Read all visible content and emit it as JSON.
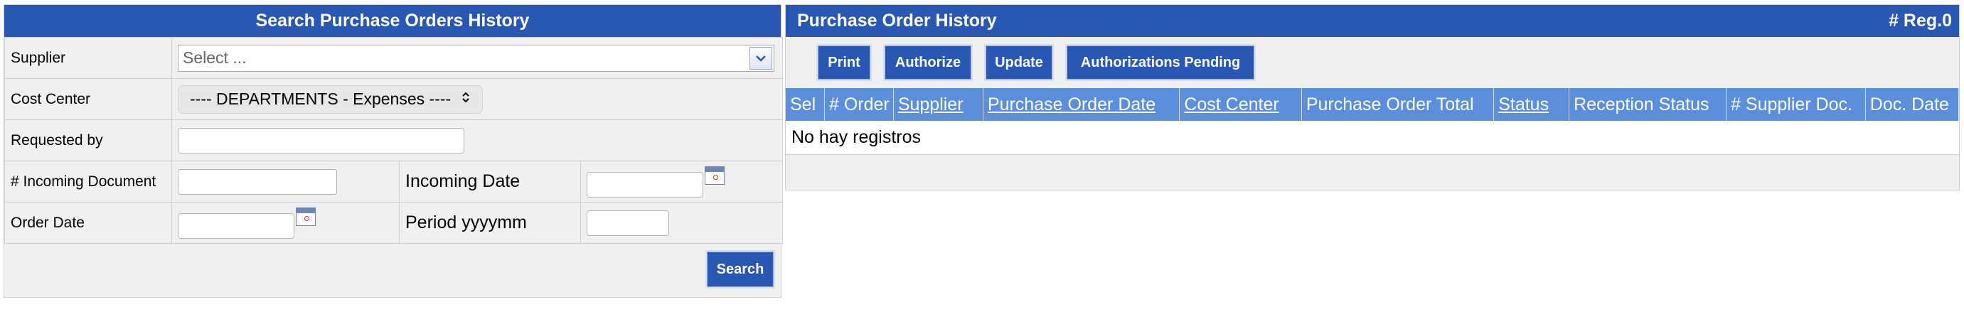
{
  "search": {
    "title": "Search Purchase Orders History",
    "supplier_label": "Supplier",
    "supplier_placeholder": "Select ...",
    "cost_center_label": "Cost Center",
    "cost_center_value": "---- DEPARTMENTS - Expenses ----",
    "requested_by_label": "Requested by",
    "incoming_doc_label": "# Incoming Document",
    "incoming_date_label": "Incoming Date",
    "order_date_label": "Order Date",
    "period_label": "Period yyyymm",
    "search_button": "Search"
  },
  "history": {
    "title": "Purchase Order History",
    "reg_count": "# Reg.0",
    "buttons": {
      "print": "Print",
      "authorize": "Authorize",
      "update": "Update",
      "pending": "Authorizations Pending"
    },
    "columns": [
      {
        "label": "Sel",
        "sortable": false
      },
      {
        "label": "# Order",
        "sortable": false
      },
      {
        "label": "Supplier",
        "sortable": true
      },
      {
        "label": "Purchase Order Date",
        "sortable": true
      },
      {
        "label": "Cost Center",
        "sortable": true
      },
      {
        "label": "Purchase Order Total",
        "sortable": false
      },
      {
        "label": "Status",
        "sortable": true
      },
      {
        "label": "Reception Status",
        "sortable": false
      },
      {
        "label": "# Supplier Doc.",
        "sortable": false
      },
      {
        "label": "Doc. Date",
        "sortable": false
      }
    ],
    "empty_message": "No hay registros"
  },
  "colors": {
    "header_bg": "#2857b4",
    "grid_header_bg": "#5b8fdc",
    "panel_bg": "#f0f0f0"
  }
}
